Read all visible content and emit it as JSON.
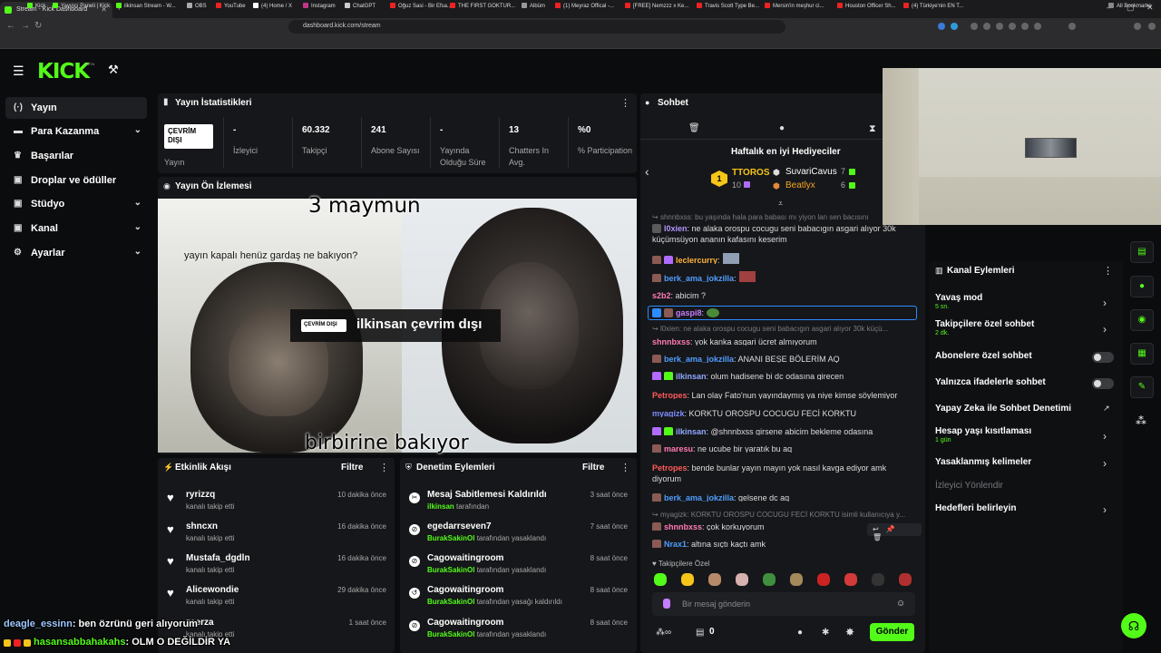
{
  "browser": {
    "tab_title": "Stream - Kick Dashboard",
    "url": "dashboard.kick.com/stream",
    "bookmarks": [
      "Kick",
      "Yayıncı Paneli | Kick",
      "ilkinsan Stream - W...",
      "OBS",
      "YouTube",
      "(4) Home / X",
      "Instagram",
      "ChatGPT",
      "Oğuz Sasi - Bir Efsa...",
      "THE FIRST GOKTUR...",
      "Albüm",
      "(1) Meyraz Offical -...",
      "[FREE] Nemzzz x Ke...",
      "Travis Scott Type Be...",
      "Mersin'in meşhur ci...",
      "Houston Officer Sh...",
      "(4) Türkiye'nin EN T..."
    ],
    "all_bookmarks": "All Bookmarks"
  },
  "brand": {
    "logo": "KICK",
    "beta": "BETA"
  },
  "sidebar": {
    "items": [
      {
        "label": "Yayın",
        "icon": "broadcast-icon"
      },
      {
        "label": "Para Kazanma",
        "icon": "money-icon"
      },
      {
        "label": "Başarılar",
        "icon": "trophy-icon"
      },
      {
        "label": "Droplar ve ödüller",
        "icon": "gift-icon"
      },
      {
        "label": "Stüdyo",
        "icon": "studio-icon"
      },
      {
        "label": "Kanal",
        "icon": "channel-icon"
      },
      {
        "label": "Ayarlar",
        "icon": "gear-icon"
      }
    ]
  },
  "stats": {
    "title": "Yayın İstatistikleri",
    "status_badge": "ÇEVRİM DIŞI",
    "status_label": "Yayın",
    "items": [
      {
        "value": "-",
        "label": "İzleyici"
      },
      {
        "value": "60.332",
        "label": "Takipçi"
      },
      {
        "value": "241",
        "label": "Abone Sayısı"
      },
      {
        "value": "-",
        "label": "Yayında Olduğu Süre"
      },
      {
        "value": "13",
        "label": "Chatters In Avg."
      },
      {
        "value": "%0",
        "label": "% Participation"
      }
    ]
  },
  "preview": {
    "title": "Yayın Ön İzlemesi",
    "caption_top": "3 maymun",
    "caption_mid": "yayın kapalı henüz gardaş ne bakıyon?",
    "caption_bottom": "birbirine bakıyor",
    "offline_chip": "ÇEVRİM DIŞI",
    "offline_title": "ilkinsan çevrim dışı"
  },
  "activity": {
    "title": "Etkinlik Akışı",
    "filter": "Filtre",
    "rows": [
      {
        "name": "ryrizzq",
        "sub": "kanalı takip etti",
        "time": "10 dakika önce"
      },
      {
        "name": "shncxn",
        "sub": "kanalı takip etti",
        "time": "16 dakika önce"
      },
      {
        "name": "Mustafa_dgdln",
        "sub": "kanalı takip etti",
        "time": "16 dakika önce"
      },
      {
        "name": "Alicewondie",
        "sub": "kanalı takip etti",
        "time": "29 dakika önce"
      },
      {
        "name": "zeerza",
        "sub": "kanalı takip etti",
        "time": "1 saat önce"
      }
    ]
  },
  "moderation": {
    "title": "Denetim Eylemleri",
    "filter": "Filtre",
    "rows": [
      {
        "name": "Mesaj Sabitlemesi Kaldırıldı",
        "actor": "ilkinsan",
        "sub": " tarafından",
        "time": "3 saat önce"
      },
      {
        "name": "egedarrseven7",
        "actor": "BurakSakinOl",
        "sub": " tarafından yasaklandı",
        "time": "7 saat önce"
      },
      {
        "name": "Cagowaitingroom",
        "actor": "BurakSakinOl",
        "sub": " tarafından yasaklandı",
        "time": "8 saat önce"
      },
      {
        "name": "Cagowaitingroom",
        "actor": "BurakSakinOl",
        "sub": " tarafından yasağı kaldırıldı",
        "time": "8 saat önce"
      },
      {
        "name": "Cagowaitingroom",
        "actor": "BurakSakinOl",
        "sub": " tarafından yasaklandı",
        "time": "8 saat önce"
      }
    ]
  },
  "chat": {
    "title": "Sohbet",
    "gifters_title": "Haftalık en iyi Hediyeciler",
    "gifters": [
      {
        "rank": "1",
        "name": "TTOROS",
        "count": "10"
      },
      {
        "rank": "",
        "name": "SuvariCavus",
        "count": "7"
      },
      {
        "rank": "",
        "name": "Beatlyx",
        "count": "6"
      }
    ],
    "messages": [
      {
        "user": "",
        "text": "shnnbxss: bu yaşında hala para babası mı yiyon lan sen bacısını",
        "reply": true
      },
      {
        "user": "l0xien",
        "text": ": ne alaka orospu cocugu seni babacıgın asgari alıyor 30k küçümsüyon ananın kafasını keserim",
        "color": "#b394ff"
      },
      {
        "user": "leclercurry",
        "text": ":",
        "color": "#ffb23a"
      },
      {
        "user": "berk_ama_jokzilla",
        "text": ":",
        "color": "#4f9dff"
      },
      {
        "user": "s2b2",
        "text": ": abicim ?",
        "color": "#ff7ab5"
      },
      {
        "user": "gaspi8",
        "text": ":",
        "color": "#c77dff"
      },
      {
        "user": "",
        "text": "l0xien: ne alaka orospu cocugu seni babacıgın asgari alıyor 30k küçü...",
        "reply": true
      },
      {
        "user": "shnnbxss",
        "text": ": yok kanka asgari ücret almıyorum",
        "color": "#ff7ab5"
      },
      {
        "user": "berk_ama_jokzilla",
        "text": ": ANANI BEŞE BÖLERİM AQ",
        "color": "#4f9dff"
      },
      {
        "user": "ilkinsan",
        "text": ": olum hadisene bi dc odasına girecen",
        "color": "#8fa8ff"
      },
      {
        "user": "Petropes",
        "text": ": Lan olay Fato'nun yayındaymış ya niye kimse söylemiyor",
        "color": "#ff5a5a"
      },
      {
        "user": "myagizk",
        "text": ": KORKTU OROSPU COCUGU FECİ KORKTU",
        "color": "#7d8cff"
      },
      {
        "user": "ilkinsan",
        "text": ": @shnnbxss girsene abicim bekleme odasına",
        "color": "#8fa8ff"
      },
      {
        "user": "maresu",
        "text": ": ne ucube bir yaratık bu aq",
        "color": "#ff7ab5"
      },
      {
        "user": "Petropes",
        "text": ": bende bunlar yayın mayın yok nasıl kavga ediyor amk diyorum",
        "color": "#ff5a5a"
      },
      {
        "user": "berk_ama_jokzilla",
        "text": ": gelsene dc aq",
        "color": "#4f9dff"
      },
      {
        "user": "",
        "text": "myagizk: KORKTU OROSPU COCUGU FECİ KORKTU isimli kullanıcıya y...",
        "reply": true
      },
      {
        "user": "shnnbxss",
        "text": ": çok korkuyorum",
        "color": "#ff7ab5"
      },
      {
        "user": "Nrax1",
        "text": ": altına sıçtı kaçtı amk",
        "color": "#4f9dff"
      }
    ],
    "followers_only": "Takipçilere Özel",
    "input_placeholder": "Bir mesaj gönderin",
    "points": "0",
    "send": "Gönder"
  },
  "channel_actions": {
    "title": "Kanal Eylemleri",
    "items": [
      {
        "label": "Yavaş mod",
        "sub": "5 sn."
      },
      {
        "label": "Takipçilere özel sohbet",
        "sub": "2 dk."
      },
      {
        "label": "Abonelere özel sohbet",
        "sub": ""
      },
      {
        "label": "Yalnızca ifadelerle sohbet",
        "sub": ""
      },
      {
        "label": "Yapay Zeka ile Sohbet Denetimi",
        "sub": ""
      },
      {
        "label": "Hesap yaşı kısıtlaması",
        "sub": "1 gün"
      },
      {
        "label": "Yasaklanmış kelimeler",
        "sub": ""
      },
      {
        "label": "İzleyici Yönlendir",
        "sub": ""
      },
      {
        "label": "Hedefleri belirleyin",
        "sub": ""
      }
    ]
  },
  "overlay_chat": [
    {
      "user": "deagle_essinn",
      "text": ": ben özrünü geri alıyorum"
    },
    {
      "user": "hasansabbahakahs",
      "text": ": OLM O DEĞİLDİR YA"
    }
  ],
  "colors": {
    "accent": "#53fc18",
    "panel": "#16171a",
    "bg": "#0b0c0e"
  }
}
